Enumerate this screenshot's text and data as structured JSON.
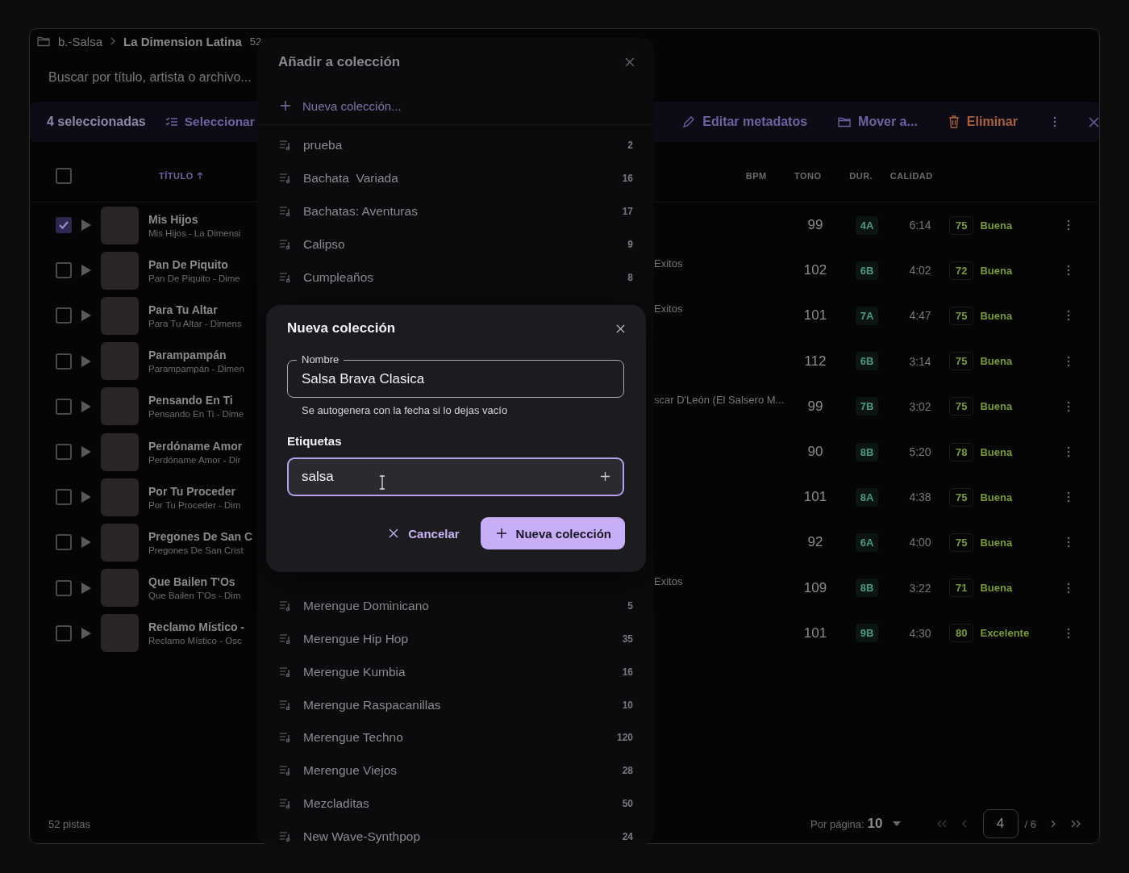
{
  "breadcrumb": {
    "folder": "b.-Salsa",
    "current": "La Dimension Latina",
    "count": "52"
  },
  "search": {
    "placeholder": "Buscar por título, artista o archivo..."
  },
  "selection_bar": {
    "count": "4 seleccionadas",
    "select_label": "Seleccionar",
    "actions": [
      {
        "kind": "edit",
        "label": "Editar metadatos"
      },
      {
        "kind": "move",
        "label": "Mover a..."
      },
      {
        "kind": "delete",
        "label": "Eliminar"
      }
    ]
  },
  "table": {
    "select_all": {
      "checked": false
    },
    "columns": [
      {
        "label": "TÍTULO",
        "sorted": true
      },
      {
        "label": "BPM",
        "sorted": false
      },
      {
        "label": "TONO",
        "sorted": false
      },
      {
        "label": "DUR.",
        "sorted": false
      },
      {
        "label": "CALIDAD",
        "sorted": false
      }
    ],
    "rows": [
      {
        "checked": true,
        "title": "Mis Hijos",
        "subtitle": "Mis Hijos - La Dimensi",
        "bpm": "99",
        "key": "4A",
        "duration": "6:14",
        "score": "75",
        "quality": "Buena"
      },
      {
        "checked": false,
        "title": "Pan De Piquito",
        "subtitle": "Pan De Piquito - Dime",
        "album": "Exitos",
        "bpm": "102",
        "key": "6B",
        "duration": "4:02",
        "score": "72",
        "quality": "Buena"
      },
      {
        "checked": false,
        "title": "Para Tu Altar",
        "subtitle": "Para Tu Altar - Dimens",
        "album": "Exitos",
        "bpm": "101",
        "key": "7A",
        "duration": "4:47",
        "score": "75",
        "quality": "Buena"
      },
      {
        "checked": false,
        "title": "Parampampán",
        "subtitle": "Parampampán - Dimen",
        "bpm": "112",
        "key": "6B",
        "duration": "3:14",
        "score": "75",
        "quality": "Buena"
      },
      {
        "checked": false,
        "title": "Pensando En Ti",
        "subtitle": "Pensando En Ti - Dime",
        "album": "scar D'León (El Salsero M...",
        "bpm": "99",
        "key": "7B",
        "duration": "3:02",
        "score": "75",
        "quality": "Buena"
      },
      {
        "checked": false,
        "title": "Perdóname Amor",
        "subtitle": "Perdóname Amor - Dir",
        "bpm": "90",
        "key": "8B",
        "duration": "5:20",
        "score": "78",
        "quality": "Buena"
      },
      {
        "checked": false,
        "title": "Por Tu Proceder",
        "subtitle": "Por Tu Proceder - Dim",
        "bpm": "101",
        "key": "8A",
        "duration": "4:38",
        "score": "75",
        "quality": "Buena"
      },
      {
        "checked": false,
        "title": "Pregones De San C",
        "subtitle": "Pregones De San Crist",
        "bpm": "92",
        "key": "6A",
        "duration": "4:00",
        "score": "75",
        "quality": "Buena"
      },
      {
        "checked": false,
        "title": "Que Bailen T'Os",
        "subtitle": "Que Bailen T'Os - Dim",
        "album": "Exitos",
        "bpm": "109",
        "key": "8B",
        "duration": "3:22",
        "score": "71",
        "quality": "Buena"
      },
      {
        "checked": false,
        "title": "Reclamo Místico -",
        "subtitle": "Reclamo Místico - Osc",
        "bpm": "101",
        "key": "9B",
        "duration": "4:30",
        "score": "80",
        "quality": "Excelente"
      }
    ]
  },
  "footer": {
    "count": "52 pistas",
    "per_page_label": "Por página:",
    "per_page": "10",
    "page": "4",
    "pages": "/ 6"
  },
  "collection_panel": {
    "title": "Añadir a colección",
    "new_label": "Nueva colección...",
    "collections": [
      {
        "name": "prueba",
        "count": "2"
      },
      {
        "name": "Bachata  Variada",
        "count": "16"
      },
      {
        "name": "Bachatas: Aventuras",
        "count": "17"
      },
      {
        "name": "Calipso",
        "count": "9"
      },
      {
        "name": "Cumpleaños",
        "count": "8"
      }
    ],
    "collections_lower": [
      {
        "name": "Merengue Dominicano",
        "count": "5"
      },
      {
        "name": "Merengue Hip Hop",
        "count": "35"
      },
      {
        "name": "Merengue Kumbia",
        "count": "16"
      },
      {
        "name": "Merengue Raspacanillas",
        "count": "10"
      },
      {
        "name": "Merengue Techno",
        "count": "120"
      },
      {
        "name": "Merengue Viejos",
        "count": "28"
      },
      {
        "name": "Mezcladitas",
        "count": "50"
      },
      {
        "name": "New Wave-Synthpop",
        "count": "24"
      }
    ]
  },
  "dialog": {
    "title": "Nueva colección",
    "name_label": "Nombre",
    "name_value": "Salsa Brava Clasica",
    "name_helper": "Se autogenera con la fecha si lo dejas vacío",
    "tags_label": "Etiquetas",
    "tags_value": "salsa",
    "cancel": "Cancelar",
    "submit": "Nueva colección"
  }
}
